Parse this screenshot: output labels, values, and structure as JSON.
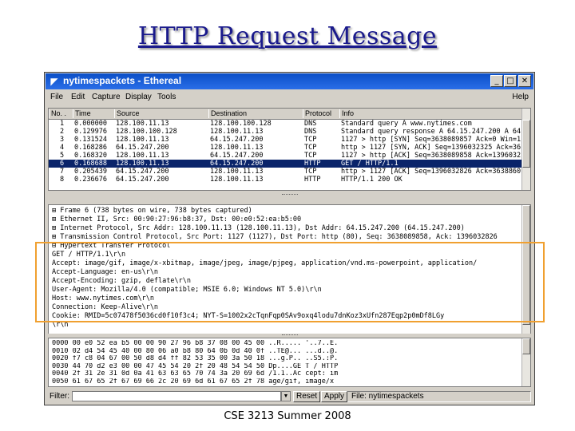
{
  "slide": {
    "title": "HTTP Request Message",
    "footer": "CSE 3213 Summer 2008"
  },
  "window": {
    "title": "nytimespackets - Ethereal",
    "app_icon": "ethereal-fin-icon",
    "controls": [
      "minimize",
      "maximize",
      "close"
    ]
  },
  "menubar": {
    "items": [
      "File",
      "Edit",
      "Capture",
      "Display",
      "Tools"
    ],
    "help": "Help"
  },
  "packet_list": {
    "columns": [
      "No. .",
      "Time",
      "Source",
      "Destination",
      "Protocol",
      "Info"
    ],
    "rows": [
      {
        "no": "1",
        "time": "0.000000",
        "src": "128.100.11.13",
        "dst": "128.100.100.128",
        "proto": "DNS",
        "info": "Standard query A www.nytimes.com",
        "selected": false
      },
      {
        "no": "2",
        "time": "0.129976",
        "src": "128.100.100.128",
        "dst": "128.100.11.13",
        "proto": "DNS",
        "info": "Standard query response A 64.15.247.200 A 64",
        "selected": false
      },
      {
        "no": "3",
        "time": "0.131524",
        "src": "128.100.11.13",
        "dst": "64.15.247.200",
        "proto": "TCP",
        "info": "1127 > http [SYN] Seq=3638089857 Ack=0 Win=1",
        "selected": false
      },
      {
        "no": "4",
        "time": "0.168286",
        "src": "64.15.247.200",
        "dst": "128.100.11.13",
        "proto": "TCP",
        "info": "http > 1127 [SYN, ACK] Seq=1396032325 Ack=36",
        "selected": false
      },
      {
        "no": "5",
        "time": "0.168320",
        "src": "128.100.11.13",
        "dst": "64.15.247.200",
        "proto": "TCP",
        "info": "1127 > http [ACK] Seq=3638089858 Ack=1396032",
        "selected": false
      },
      {
        "no": "6",
        "time": "0.168688",
        "src": "128.100.11.13",
        "dst": "64.15.247.200",
        "proto": "HTTP",
        "info": "GET / HTTP/1.1",
        "selected": true
      },
      {
        "no": "7",
        "time": "0.205439",
        "src": "64.15.247.200",
        "dst": "128.100.11.13",
        "proto": "TCP",
        "info": "http > 1127 [ACK] Seq=1396032826 Ack=3638860",
        "selected": false
      },
      {
        "no": "8",
        "time": "0.236676",
        "src": "64.15.247.200",
        "dst": "128.100.11.13",
        "proto": "HTTP",
        "info": "HTTP/1.1 200 OK",
        "selected": false
      }
    ]
  },
  "packet_detail": {
    "lines": [
      "⊞ Frame 6 (738 bytes on wire, 738 bytes captured)",
      "⊞ Ethernet II, Src: 00:90:27:96:b8:37, Dst: 00:e0:52:ea:b5:00",
      "⊞ Internet Protocol, Src Addr: 128.100.11.13 (128.100.11.13), Dst Addr: 64.15.247.200 (64.15.247.200)",
      "⊞ Transmission Control Protocol, Src Port: 1127 (1127), Dst Port: http (80), Seq: 3638089858, Ack: 1396032826",
      "⊟ Hypertext Transfer Protocol",
      "     GET / HTTP/1.1\\r\\n",
      "     Accept: image/gif, image/x-xbitmap, image/jpeg, image/pjpeg, application/vnd.ms-powerpoint, application/",
      "     Accept-Language: en-us\\r\\n",
      "     Accept-Encoding: gzip, deflate\\r\\n",
      "     User-Agent: Mozilla/4.0 (compatible; MSIE 6.0; Windows NT 5.0)\\r\\n",
      "     Host: www.nytimes.com\\r\\n",
      "     Connection: Keep-Alive\\r\\n",
      "     Cookie: RMID=5c07478f5036cd0f10f3c4; NYT-S=1002x2cTqnFqp0SAv9oxq4lodu7dnKoz3xUfn287Eqp2p0mDf8LGy",
      "     \\r\\n"
    ]
  },
  "hex_dump": {
    "lines": [
      "0000  00 e0 52 ea b5 00 00 90  27 96 b8 37 08 00 45 00   ..R..... '..7..E.",
      "0010  02 d4 54 45 40 00 80 06  a0 b8 80 64 0b 0d 40 0f   ..TE@... ...d..@.",
      "0020  f7 c8 04 67 00 50 d8 d4  ff 82 53 35 00 3a 50 18   ...g.P.. ..S5.:P.",
      "0030  44 70 d2 e3 00 00 47 45  54 20 2f 20 48 54 54 50   Dp....GE T / HTTP",
      "0040  2f 31 2e 31 0d 0a 41 63  63 65 70 74 3a 20 69 6d   /1.1..Ac cept: im",
      "0050  61 67 65 2f 67 69 66 2c  20 69 6d 61 67 65 2f 78   age/gif,  image/x"
    ]
  },
  "filter_bar": {
    "label": "Filter:",
    "value": "",
    "reset_label": "Reset",
    "apply_label": "Apply",
    "status": "File: nytimespackets"
  },
  "colors": {
    "title_text": "#1a1a8c",
    "titlebar": "#0b4fc7",
    "selection": "#0a246a",
    "highlight_box": "#f0a030"
  }
}
